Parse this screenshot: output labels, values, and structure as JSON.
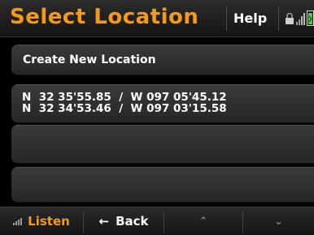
{
  "header": {
    "title": "Select Location",
    "help_label": "Help"
  },
  "list": {
    "create_label": "Create New Location",
    "locations": [
      {
        "line1": "N  32 35'55.85  /  W 097 05'45.12",
        "line2": "N  32 34'53.46  /  W 097 03'15.58"
      }
    ]
  },
  "footer": {
    "listen_label": "Listen",
    "back_label": "Back",
    "back_arrow": "←",
    "up_chevron": "⌃",
    "down_chevron": "⌄"
  },
  "colors": {
    "accent": "#f39a1b",
    "battery": "#4cd137"
  },
  "icons": [
    "lock-icon",
    "signal-icon",
    "battery-icon",
    "speaker-bars-icon"
  ]
}
